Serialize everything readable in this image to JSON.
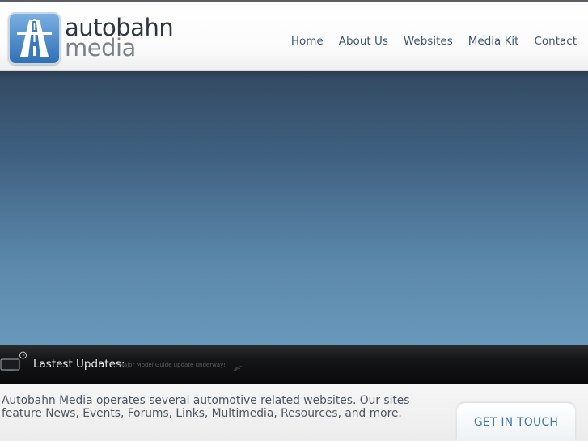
{
  "brand": {
    "line1": "autobahn",
    "line2": "media",
    "logo_icon": "highway-road-icon",
    "accent_color": "#3a7bbf"
  },
  "nav": {
    "items": [
      {
        "label": "Home"
      },
      {
        "label": "About Us"
      },
      {
        "label": "Websites"
      },
      {
        "label": "Media Kit"
      },
      {
        "label": "Contact"
      }
    ]
  },
  "updates": {
    "label": "Lastest Updates:",
    "text": "Major Model Guide update underway!",
    "icon": "monitor-clock-icon",
    "feed_icon": "rss-icon"
  },
  "intro": {
    "text": "Autobahn Media operates several automotive related websites. Our sites feature News, Events, Forums, Links, Multimedia, Resources, and more."
  },
  "cta": {
    "label": "GET IN TOUCH"
  }
}
